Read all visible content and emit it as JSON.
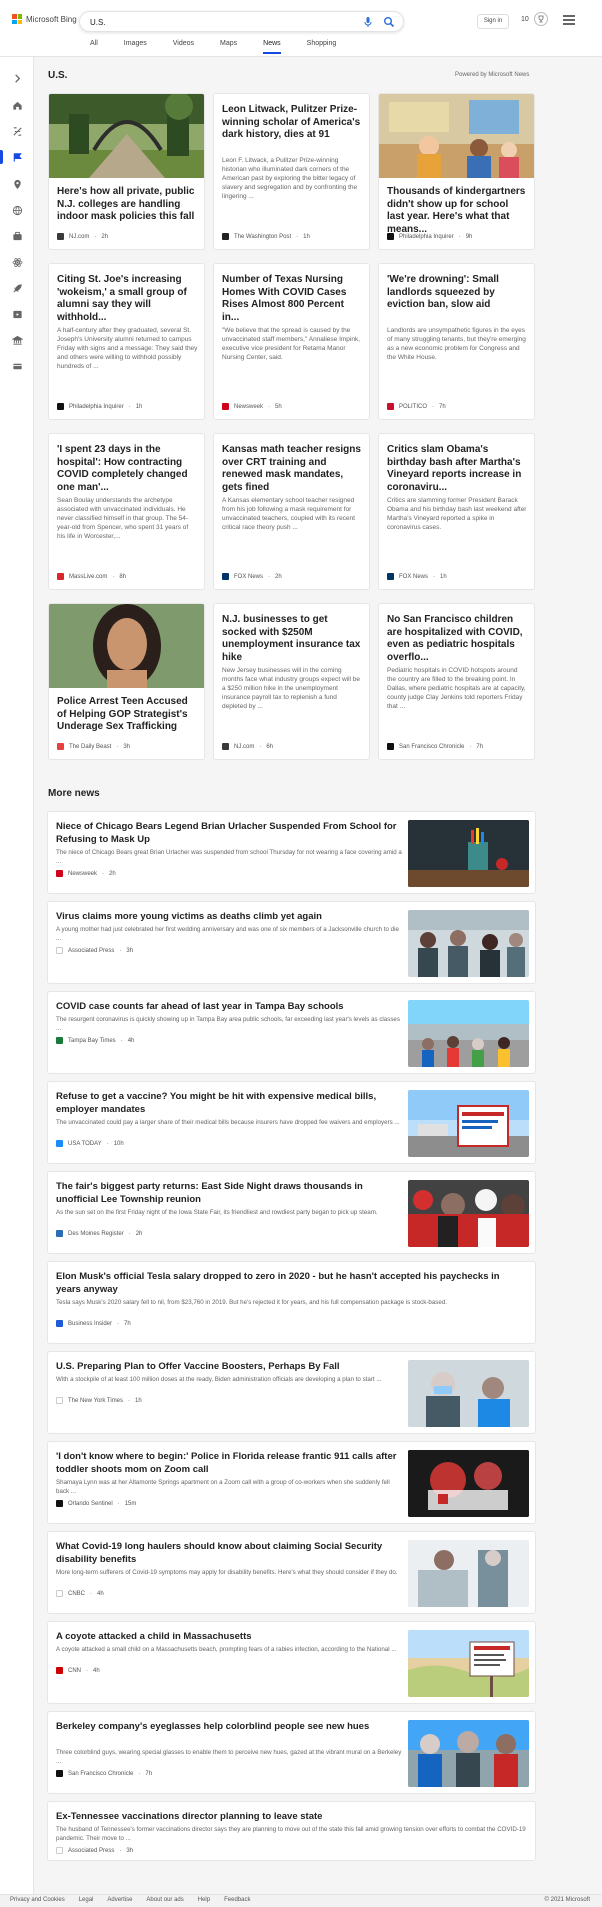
{
  "header": {
    "brand": "Microsoft Bing",
    "search_value": "U.S.",
    "sign_in": "Sign in",
    "rewards_count": "10",
    "tabs": [
      {
        "label": "All",
        "active": false
      },
      {
        "label": "Images",
        "active": false
      },
      {
        "label": "Videos",
        "active": false
      },
      {
        "label": "Maps",
        "active": false
      },
      {
        "label": "News",
        "active": true
      },
      {
        "label": "Shopping",
        "active": false
      }
    ]
  },
  "rail_icons": [
    "expand-icon",
    "home-icon",
    "discover-icon",
    "flag-icon",
    "location-icon",
    "globe-icon",
    "business-icon",
    "science-icon",
    "rocket-icon",
    "entertainment-icon",
    "bank-icon",
    "finance-icon"
  ],
  "section": {
    "title": "U.S.",
    "powered_by": "Powered by Microsoft News"
  },
  "cards": [
    {
      "title": "Here's how all private, public N.J. colleges are handling indoor mask policies this fall",
      "desc": "",
      "source": "NJ.com",
      "time": "2h",
      "logo_color": "#3a3a3a",
      "img": "garden"
    },
    {
      "title": "Leon Litwack, Pulitzer Prize-winning scholar of America's dark history, dies at 91",
      "desc": "Leon F. Litwack, a Pulitzer Prize-winning historian who illuminated dark corners of the American past by exploring the bitter legacy of slavery and segregation and by confronting the lingering ...",
      "source": "The Washington Post",
      "time": "1h",
      "logo_color": "#222222",
      "img": ""
    },
    {
      "title": "Thousands of kindergartners didn't show up for school last year. Here's what that means...",
      "desc": "",
      "source": "Philadelphia Inquirer",
      "time": "9h",
      "logo_color": "#111111",
      "img": "classroom"
    },
    {
      "title": "Citing St. Joe's increasing 'wokeism,' a small group of alumni say they will withhold...",
      "desc": "A half-century after they graduated, several St. Joseph's University alumni returned to campus Friday with signs and a message: They said they and others were willing to withhold possibly hundreds of ...",
      "source": "Philadelphia Inquirer",
      "time": "1h",
      "logo_color": "#111111",
      "img": ""
    },
    {
      "title": "Number of Texas Nursing Homes With COVID Cases Rises Almost 800 Percent in...",
      "desc": "\"We believe that the spread is caused by the unvaccinated staff members,\" Annaliese Impink, executive vice president for Retama Manor Nursing Center, said.",
      "source": "Newsweek",
      "time": "5h",
      "logo_color": "#d0021b",
      "img": ""
    },
    {
      "title": "'We're drowning': Small landlords squeezed by eviction ban, slow aid",
      "desc": "Landlords are unsympathetic figures in the eyes of many struggling tenants, but they're emerging as a new economic problem for Congress and the White House.",
      "source": "POLITICO",
      "time": "7h",
      "logo_color": "#c8102e",
      "img": ""
    },
    {
      "title": "'I spent 23 days in the hospital': How contracting COVID completely changed one man'...",
      "desc": "Sean Boulay understands the archetype associated with unvaccinated individuals. He never classified himself in that group. The 54-year-old from Spencer, who spent 31 years of his life in Worcester,...",
      "source": "MassLive.com",
      "time": "8h",
      "logo_color": "#d9262c",
      "img": ""
    },
    {
      "title": "Kansas math teacher resigns over CRT training and renewed mask mandates, gets fined",
      "desc": "A Kansas elementary school teacher resigned from his job following a mask requirement for unvaccinated teachers, coupled with its recent critical race theory push ...",
      "source": "FOX News",
      "time": "2h",
      "logo_color": "#003366",
      "img": ""
    },
    {
      "title": "Critics slam Obama's birthday bash after Martha's Vineyard reports increase in coronaviru...",
      "desc": "Critics are slamming former President Barack Obama and his birthday bash last weekend after Martha's Vineyard reported a spike in coronavirus cases.",
      "source": "FOX News",
      "time": "1h",
      "logo_color": "#003366",
      "img": ""
    },
    {
      "title": "Police Arrest Teen Accused of Helping GOP Strategist's Underage Sex Trafficking",
      "desc": "",
      "source": "The Daily Beast",
      "time": "3h",
      "logo_color": "#e8403f",
      "img": "portrait"
    },
    {
      "title": "N.J. businesses to get socked with $250M unemployment insurance tax hike",
      "desc": "New Jersey businesses will in the coming months face what industry groups expect will be a $250 million hike in the unemployment insurance payroll tax to replenish a fund depleted by ...",
      "source": "NJ.com",
      "time": "6h",
      "logo_color": "#3a3a3a",
      "img": ""
    },
    {
      "title": "No San Francisco children are hospitalized with COVID, even as pediatric hospitals overflo...",
      "desc": "Pediatric hospitals in COVID hotspots around the country are filled to the breaking point. In Dallas, where pediatric hospitals are at capacity, county judge Clay Jenkins told reporters Friday that ...",
      "source": "San Francisco Chronicle",
      "time": "7h",
      "logo_color": "#111111",
      "img": ""
    }
  ],
  "more_news": {
    "title": "More news",
    "items": [
      {
        "title": "Niece of Chicago Bears Legend Brian Urlacher Suspended From School for Refusing to Mask Up",
        "desc": "The niece of Chicago Bears great Brian Urlacher was suspended from school Thursday for not wearing a face covering amid a ...",
        "source": "Newsweek",
        "time": "2h",
        "logo_color": "#d0021b",
        "img": "desk"
      },
      {
        "title": "Virus claims more young victims as deaths climb yet again",
        "desc": "A young mother had just celebrated her first wedding anniversary and was one of six members of a Jacksonville church to die ...",
        "source": "Associated Press",
        "time": "3h",
        "logo_color": "#ffffff",
        "img": "crowd"
      },
      {
        "title": "COVID case counts far ahead of last year in Tampa Bay schools",
        "desc": "The resurgent coronavirus is quickly showing up in Tampa Bay area public schools, far exceeding last year's levels as classes ...",
        "source": "Tampa Bay Times",
        "time": "4h",
        "logo_color": "#1a7a3a",
        "img": "school"
      },
      {
        "title": "Refuse to get a vaccine? You might be hit with expensive medical bills, employer mandates",
        "desc": "The unvaccinated could pay a larger share of their medical bills because insurers have dropped fee waivers and employers ...",
        "source": "USA TODAY",
        "time": "10h",
        "logo_color": "#1a8cff",
        "img": "sign"
      },
      {
        "title": "The fair's biggest party returns: East Side Night draws thousands in unofficial Lee Township reunion",
        "desc": "As the sun set on the first Friday night of the Iowa State Fair, its friendliest and rowdiest party began to pick up steam.",
        "source": "Des Moines Register",
        "time": "2h",
        "logo_color": "#2d6db5",
        "img": "party"
      },
      {
        "title": "Elon Musk's official Tesla salary dropped to zero in 2020 - but he hasn't accepted his paychecks in years anyway",
        "desc": "Tesla says Musk's 2020 salary fell to nil, from $23,760 in 2019. But he's rejected it for years, and his full compensation package is stock-based.",
        "source": "Business Insider",
        "time": "7h",
        "logo_color": "#1f5bd6",
        "img": ""
      },
      {
        "title": "U.S. Preparing Plan to Offer Vaccine Boosters, Perhaps By Fall",
        "desc": "With a stockpile of at least 100 million doses at the ready, Biden administration officials are developing a plan to start ...",
        "source": "The New York Times",
        "time": "1h",
        "logo_color": "#ffffff",
        "img": "vaccine"
      },
      {
        "title": "'I don't know where to begin:' Police in Florida release frantic 911 calls after toddler shoots mom on Zoom call",
        "desc": "Shamaya Lynn was at her Altamonte Springs apartment on a Zoom call with a group of co-workers when she suddenly fell back ...",
        "source": "Orlando Sentinel",
        "time": "15m",
        "logo_color": "#111111",
        "img": "ambulance"
      },
      {
        "title": "What Covid-19 long haulers should know about claiming Social Security disability benefits",
        "desc": "More long-term sufferers of Covid-19 symptoms may apply for disability benefits. Here's what they should consider if they do.",
        "source": "CNBC",
        "time": "4h",
        "logo_color": "#ffffff",
        "img": "hospital"
      },
      {
        "title": "A coyote attacked a child in Massachusetts",
        "desc": "A coyote attacked a small child on a Massachusetts beach, prompting fears of a rabies infection, according to the National ...",
        "source": "CNN",
        "time": "4h",
        "logo_color": "#cc0000",
        "img": "beach"
      },
      {
        "title": "Berkeley company's eyeglasses help colorblind people see new hues",
        "desc": "Three colorblind guys, wearing special glasses to enable them to perceive new hues, gazed at the vibrant mural on a Berkeley ...",
        "source": "San Francisco Chronicle",
        "time": "7h",
        "logo_color": "#111111",
        "img": "glasses"
      },
      {
        "title": "Ex-Tennessee vaccinations director planning to leave state",
        "desc": "The husband of Tennessee's former vaccinations director says they are planning to move out of the state this fall amid growing tension over efforts to combat the COVID-19 pandemic. Their move to ...",
        "source": "Associated Press",
        "time": "3h",
        "logo_color": "#ffffff",
        "img": ""
      }
    ]
  },
  "footer": {
    "links": [
      "Privacy and Cookies",
      "Legal",
      "Advertise",
      "About our ads",
      "Help",
      "Feedback"
    ],
    "copyright": "© 2021 Microsoft"
  }
}
